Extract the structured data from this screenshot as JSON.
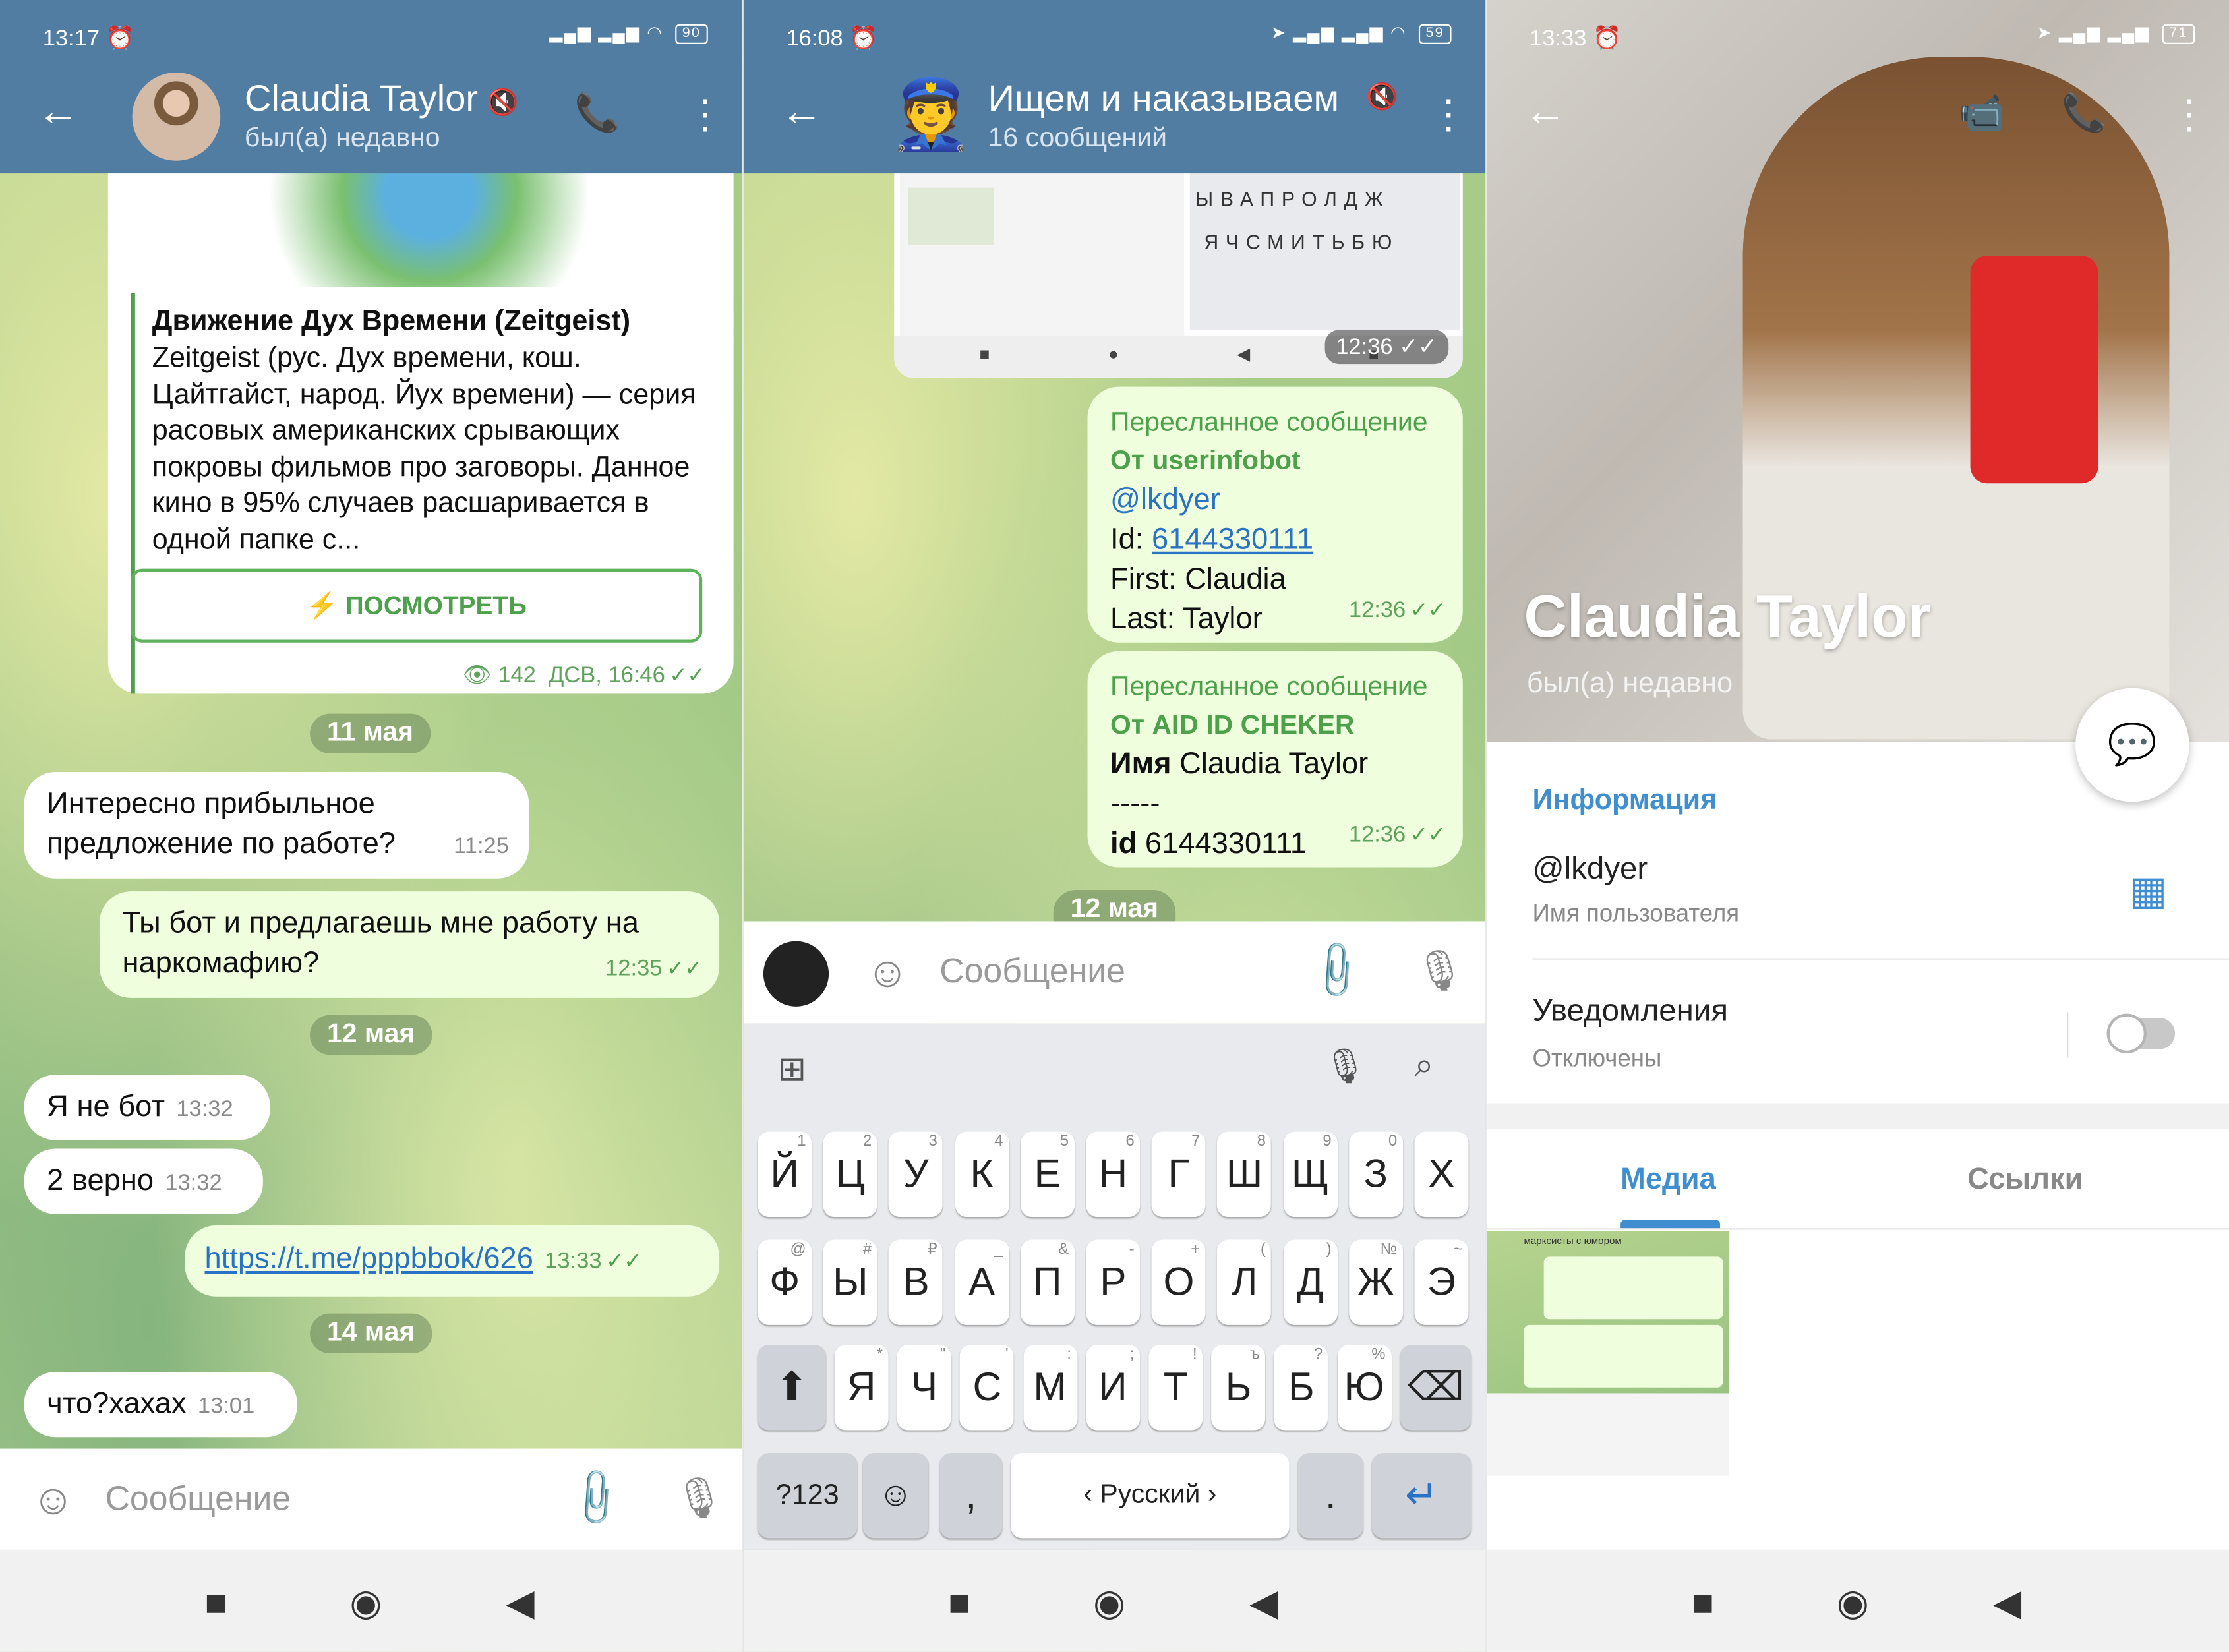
{
  "panel1": {
    "status": {
      "time": "13:17",
      "battery": "90"
    },
    "header": {
      "title": "Claudia Taylor",
      "subtitle": "был(а) недавно"
    },
    "preview": {
      "title": "Движение Дух Времени (Zeitgeist)",
      "text": "Zeitgeist (рус. Дух времени, кош. Цайтгайст, народ. Йух времени) — серия расовых американских срывающих покровы фильмов про заговоры. Данное кино в 95% случаев расшаривается в одной папке с...",
      "button": "ПОСМОТРЕТЬ",
      "views": "142",
      "meta": "ДСВ, 16:46"
    },
    "dates": [
      "11 мая",
      "12 мая",
      "14 мая"
    ],
    "messages": [
      {
        "text": "Интересно прибыльное предложение по работе?",
        "time": "11:25"
      },
      {
        "text": "Ты бот и предлагаешь мне работу на наркомафию?",
        "time": "12:35"
      },
      {
        "text": "Я не бот",
        "time": "13:32"
      },
      {
        "text": "2 верно",
        "time": "13:32"
      },
      {
        "text": "https://t.me/pppbbok/626",
        "time": "13:33"
      },
      {
        "text": "что?хахах",
        "time": "13:01"
      }
    ],
    "input_placeholder": "Сообщение"
  },
  "panel2": {
    "status": {
      "time": "16:08",
      "battery": "59"
    },
    "header": {
      "title": "Ищем и наказываем",
      "subtitle": "16 сообщений"
    },
    "img_time": "12:36",
    "fwd1": {
      "label": "Пересланное сообщение",
      "from": "От userinfobot",
      "user": "@lkdyer",
      "id_label": "Id: ",
      "id": "6144330111",
      "first": "First: Claudia",
      "last": "Last: Taylor",
      "time": "12:36"
    },
    "fwd2": {
      "label": "Пересланное сообщение",
      "from": "От AID ID CHEKER",
      "name_label": "Имя",
      "name": "Claudia Taylor",
      "sep": "-----",
      "id_label": "id",
      "id": "6144330111",
      "time": "12:36"
    },
    "date": "12 мая",
    "input_placeholder": "Сообщение",
    "keyboard": {
      "row1": [
        "Й",
        "Ц",
        "У",
        "К",
        "Е",
        "Н",
        "Г",
        "Ш",
        "Щ",
        "З",
        "Х"
      ],
      "row1sup": [
        "1",
        "2",
        "3",
        "4",
        "5",
        "6",
        "7",
        "8",
        "9",
        "0",
        ""
      ],
      "row2": [
        "Ф",
        "Ы",
        "В",
        "А",
        "П",
        "Р",
        "О",
        "Л",
        "Д",
        "Ж",
        "Э"
      ],
      "row2sup": [
        "@",
        "#",
        "₽",
        "_",
        "&",
        "-",
        "+",
        "(",
        ")",
        "№",
        "~"
      ],
      "row3": [
        "Я",
        "Ч",
        "С",
        "М",
        "И",
        "Т",
        "Ь",
        "Б",
        "Ю"
      ],
      "row3sup": [
        "*",
        "\"",
        "'",
        ":",
        ";",
        "!",
        "ъ",
        "?",
        "%"
      ],
      "sym": "?123",
      "comma": ",",
      "space": "Русский",
      "period": "."
    }
  },
  "panel3": {
    "status": {
      "time": "13:33",
      "battery": "71"
    },
    "name": "Claudia Taylor",
    "last_seen": "был(а) недавно",
    "info_title": "Информация",
    "username": "@lkdyer",
    "username_label": "Имя пользователя",
    "notif_label": "Уведомления",
    "notif_value": "Отключены",
    "tabs": [
      "Медиа",
      "Ссылки"
    ],
    "media_thumb_text": "марксисты с юмором"
  }
}
